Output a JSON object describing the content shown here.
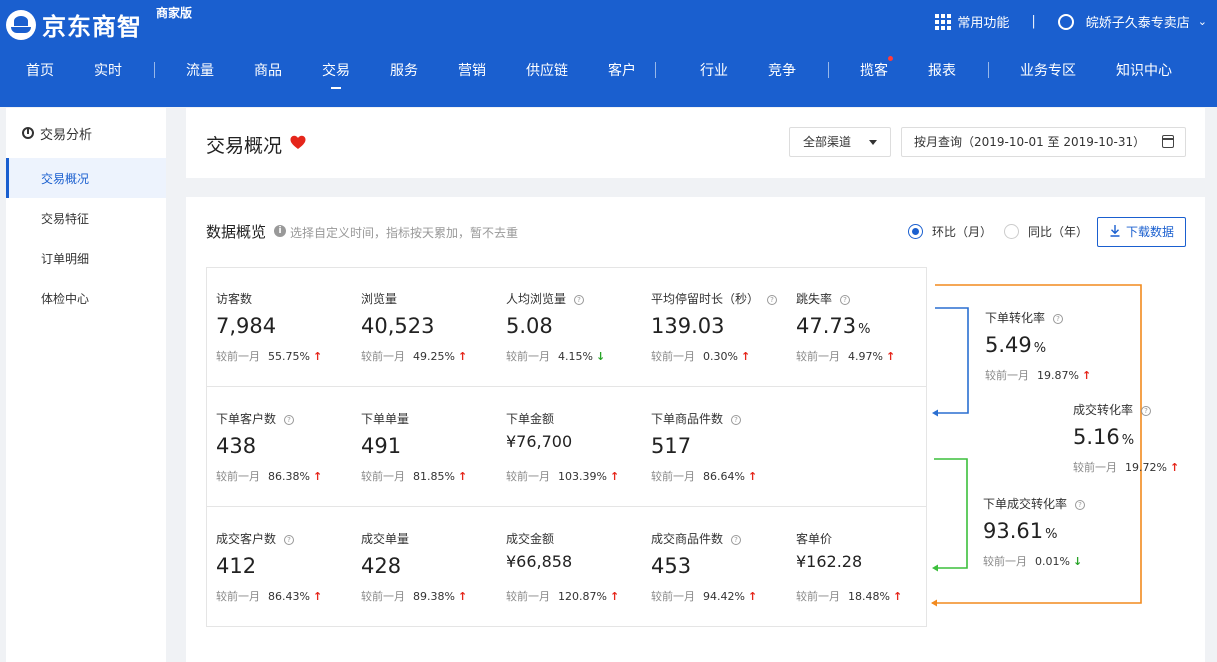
{
  "header": {
    "brand": "京东商智",
    "brand_sub": "商家版",
    "common_features": "常用功能",
    "separator": "|",
    "shop_name": "皖娇子久泰专卖店",
    "nav": [
      "首页",
      "实时",
      "流量",
      "商品",
      "交易",
      "服务",
      "营销",
      "供应链",
      "客户",
      "行业",
      "竞争",
      "揽客",
      "报表",
      "业务专区",
      "知识中心"
    ],
    "active_nav": "交易"
  },
  "sidebar": {
    "title": "交易分析",
    "items": [
      "交易概况",
      "交易特征",
      "订单明细",
      "体检中心"
    ],
    "active": "交易概况"
  },
  "title_card": {
    "title": "交易概况",
    "channel_select": "全部渠道",
    "date_range": "按月查询（2019-10-01 至 2019-10-31）"
  },
  "overview": {
    "title": "数据概览",
    "tip": "选择自定义时间，指标按天累加，暂不去重",
    "info_glyph": "i",
    "radio_mom": "环比（月）",
    "radio_yoy": "同比（年）",
    "download": "下载数据",
    "compare_label": "较前一月",
    "q_glyph": "?",
    "rows": [
      [
        {
          "label": "访客数",
          "value": "7,984",
          "pct": "55.75%",
          "dir": "↑"
        },
        {
          "label": "浏览量",
          "value": "40,523",
          "pct": "49.25%",
          "dir": "↑"
        },
        {
          "label": "人均浏览量",
          "value": "5.08",
          "pct": "4.15%",
          "dir": "↓"
        },
        {
          "label": "平均停留时长（秒）",
          "value": "139.03",
          "pct": "0.30%",
          "dir": "↑"
        },
        {
          "label": "跳失率",
          "value": "47.73",
          "unit": "%",
          "pct": "4.97%",
          "dir": "↑"
        }
      ],
      [
        {
          "label": "下单客户数",
          "value": "438",
          "pct": "86.38%",
          "dir": "↑"
        },
        {
          "label": "下单单量",
          "value": "491",
          "pct": "81.85%",
          "dir": "↑"
        },
        {
          "label": "下单金额",
          "value": "¥76,700",
          "pct": "103.39%",
          "dir": "↑"
        },
        {
          "label": "下单商品件数",
          "value": "517",
          "pct": "86.64%",
          "dir": "↑"
        }
      ],
      [
        {
          "label": "成交客户数",
          "value": "412",
          "pct": "86.43%",
          "dir": "↑"
        },
        {
          "label": "成交单量",
          "value": "428",
          "pct": "89.38%",
          "dir": "↑"
        },
        {
          "label": "成交金额",
          "value": "¥66,858",
          "pct": "120.87%",
          "dir": "↑"
        },
        {
          "label": "成交商品件数",
          "value": "453",
          "pct": "94.42%",
          "dir": "↑"
        },
        {
          "label": "客单价",
          "value": "¥162.28",
          "pct": "18.48%",
          "dir": "↑"
        }
      ]
    ],
    "conversions": [
      {
        "label": "下单转化率",
        "value": "5.49",
        "unit": "%",
        "pct": "19.87%",
        "dir": "↑"
      },
      {
        "label": "成交转化率",
        "value": "5.16",
        "unit": "%",
        "pct": "19.72%",
        "dir": "↑"
      },
      {
        "label": "下单成交转化率",
        "value": "93.61",
        "unit": "%",
        "pct": "0.01%",
        "dir": "↓"
      }
    ]
  },
  "colors": {
    "brand_blue": "#1a5fcf",
    "up_red": "#e5261b",
    "down_green": "#27a327",
    "flow_orange": "#f28a1e",
    "flow_blue": "#2a6fd1",
    "flow_green": "#3cbf3c",
    "heart": "#e5261b"
  }
}
